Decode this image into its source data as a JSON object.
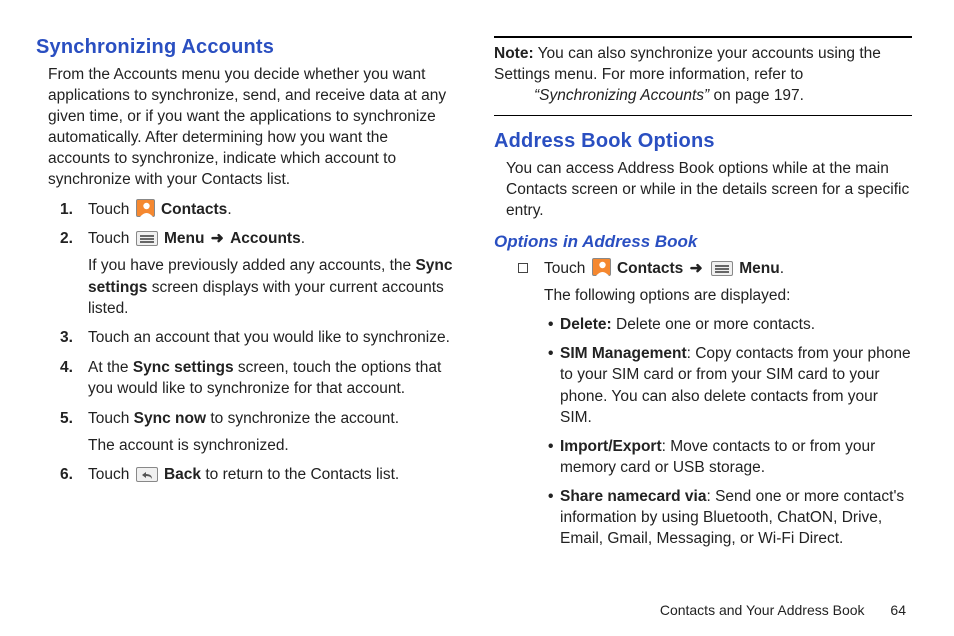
{
  "left": {
    "heading": "Synchronizing Accounts",
    "intro": "From the Accounts menu you decide whether you want applications to synchronize, send, and receive data at any given time, or if you want the applications to synchronize automatically. After determining how you want the accounts to synchronize, indicate which account to synchronize with your Contacts list.",
    "steps": {
      "s1": {
        "pre": "Touch ",
        "post": "."
      },
      "s2": {
        "pre": "Touch ",
        "menu": "Menu",
        "accounts": "Accounts",
        "post": ".",
        "sub_a": "If you have previously added any accounts, the ",
        "sub_bold": "Sync settings",
        "sub_b": " screen displays with your current accounts listed."
      },
      "s3": "Touch an account that you would like to synchronize.",
      "s4": {
        "a": "At the ",
        "bold": "Sync settings",
        "b": " screen, touch the options that you would like to synchronize for that account."
      },
      "s5": {
        "a": "Touch ",
        "bold": "Sync now",
        "b": " to synchronize the account.",
        "sub": "The account is synchronized."
      },
      "s6": {
        "a": "Touch ",
        "bold": "Back",
        "b": " to return to the Contacts list."
      }
    },
    "labels": {
      "contacts": "Contacts"
    }
  },
  "right": {
    "note": {
      "label": "Note:",
      "a": " You can also synchronize your accounts using the Settings menu. For more information, refer to ",
      "ref": "“Synchronizing Accounts”",
      "b": "  on page 197."
    },
    "heading": "Address Book Options",
    "intro": "You can access Address Book options while at the main Contacts screen or while in the details screen for a specific entry.",
    "subheading": "Options in Address Book",
    "touchline": {
      "pre": "Touch ",
      "contacts": "Contacts",
      "menu": "Menu",
      "post": ".",
      "sub": "The following options are displayed:"
    },
    "options": {
      "delete": {
        "name": "Delete:",
        "desc": " Delete one or more contacts."
      },
      "sim": {
        "name": "SIM Management",
        "desc": ": Copy contacts from your phone to your SIM card or from your SIM card to your phone. You can also delete contacts from your SIM."
      },
      "import": {
        "name": "Import/Export",
        "desc": ": Move contacts to or from your memory card or USB storage."
      },
      "share": {
        "name": "Share namecard via",
        "desc": ": Send one or more contact's information by using Bluetooth, ChatON, Drive, Email, Gmail, Messaging, or Wi-Fi Direct."
      }
    }
  },
  "footer": {
    "chapter": "Contacts and Your Address Book",
    "page": "64"
  }
}
